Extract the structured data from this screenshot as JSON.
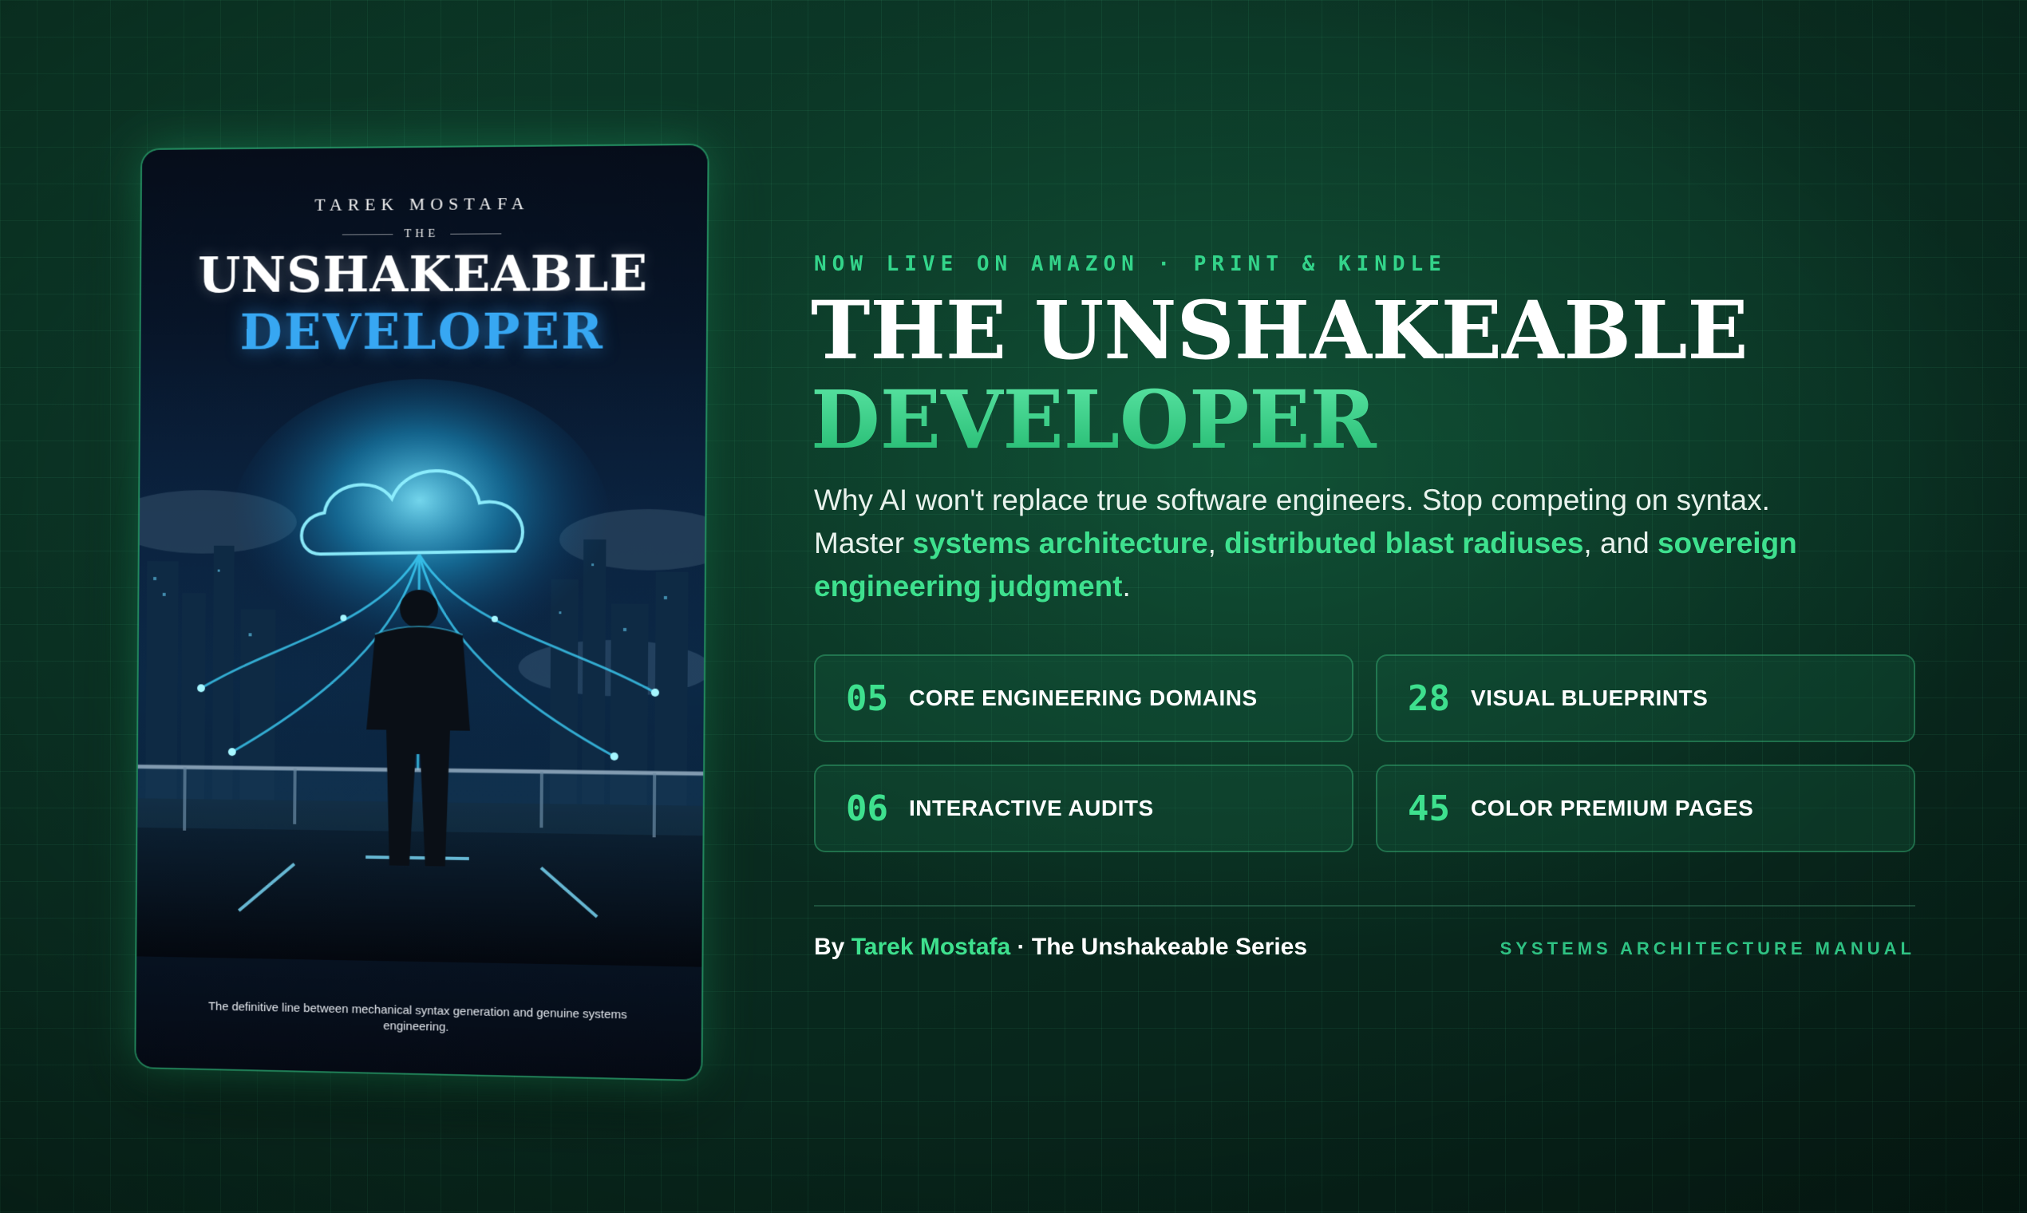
{
  "cover": {
    "author": "TAREK MOSTAFA",
    "the": "THE",
    "title_line1": "UNSHAKEABLE",
    "title_line2": "DEVELOPER",
    "tagline": "The definitive line between mechanical syntax generation and genuine systems engineering."
  },
  "hero": {
    "eyebrow": "NOW LIVE ON AMAZON · PRINT & KINDLE",
    "title_line1": "THE UNSHAKEABLE",
    "title_line2": "DEVELOPER",
    "description": {
      "part1": "Why AI won't replace true software engineers. Stop competing on syntax. Master ",
      "highlight1": "systems architecture",
      "sep1": ", ",
      "highlight2": "distributed blast radiuses",
      "sep2": ", and ",
      "highlight3": "sovereign engineering judgment",
      "end": "."
    }
  },
  "stats": [
    {
      "number": "05",
      "label": "CORE ENGINEERING DOMAINS"
    },
    {
      "number": "28",
      "label": "VISUAL BLUEPRINTS"
    },
    {
      "number": "06",
      "label": "INTERACTIVE AUDITS"
    },
    {
      "number": "45",
      "label": "COLOR PREMIUM PAGES"
    }
  ],
  "footer": {
    "by": "By ",
    "author": "Tarek Mostafa",
    "series": " · The Unshakeable Series",
    "tag": "SYSTEMS ARCHITECTURE MANUAL"
  },
  "colors": {
    "accent": "#3ee08e",
    "background": "#0a2f22",
    "cover_blue": "#37a7f2"
  }
}
